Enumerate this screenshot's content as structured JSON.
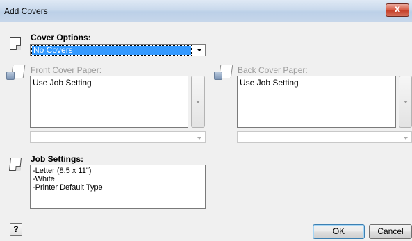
{
  "window": {
    "title": "Add Covers",
    "close_glyph": "x"
  },
  "cover_options": {
    "label": "Cover Options:",
    "selected": "No Covers"
  },
  "front_cover": {
    "label": "Front Cover Paper:",
    "list_value": "Use Job Setting",
    "combo_value": ""
  },
  "back_cover": {
    "label": "Back Cover Paper:",
    "list_value": "Use Job Setting",
    "combo_value": ""
  },
  "job_settings": {
    "label": "Job Settings:",
    "lines": [
      "-Letter (8.5 x 11\")",
      "-White",
      "-Printer Default Type"
    ]
  },
  "footer": {
    "help_label": "?",
    "ok_label": "OK",
    "cancel_label": "Cancel"
  },
  "icons": {
    "cover_options": "document-icon",
    "front_cover": "paper-tray-icon",
    "back_cover": "paper-tray-icon",
    "job_settings": "document-icon"
  }
}
